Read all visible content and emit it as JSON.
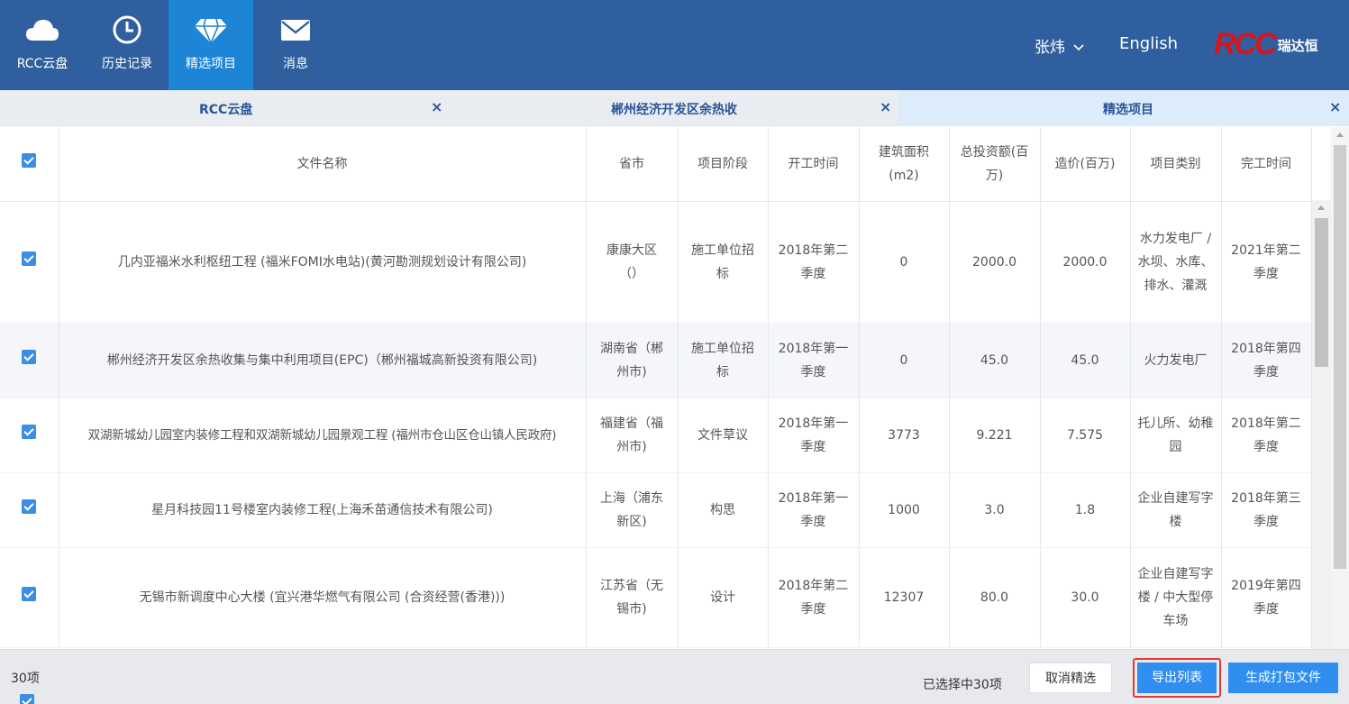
{
  "nav": [
    {
      "label": "RCC云盘",
      "icon": "cloud-icon"
    },
    {
      "label": "历史记录",
      "icon": "clock-icon"
    },
    {
      "label": "精选项目",
      "icon": "diamond-icon"
    },
    {
      "label": "消息",
      "icon": "mail-icon"
    }
  ],
  "header": {
    "user": "张炜",
    "language": "English",
    "logo_mark": "RCC",
    "logo_text": "瑞达恒"
  },
  "tabs": [
    {
      "label": "RCC云盘",
      "close": "×"
    },
    {
      "label": "郴州经济开发区余热收",
      "close": "×"
    },
    {
      "label": "精选项目",
      "close": "×"
    }
  ],
  "table": {
    "columns": [
      "文件名称",
      "省市",
      "项目阶段",
      "开工时间",
      "建筑面积(m2)",
      "总投资额(百万)",
      "造价(百万)",
      "项目类别",
      "完工时间"
    ],
    "rows": [
      {
        "name": "几内亚福米水利枢纽工程 (福米FOMI水电站)(黄河勘测规划设计有限公司)",
        "province": "康康大区（）",
        "stage": "施工单位招标",
        "start": "2018年第二季度",
        "area": "0",
        "investment": "2000.0",
        "cost": "2000.0",
        "category": "水力发电厂 / 水坝、水库、排水、灌溉",
        "finish": "2021年第二季度"
      },
      {
        "name": "郴州经济开发区余热收集与集中利用项目(EPC)（郴州福城高新投资有限公司)",
        "province": "湖南省（郴州市)",
        "stage": "施工单位招标",
        "start": "2018年第一季度",
        "area": "0",
        "investment": "45.0",
        "cost": "45.0",
        "category": "火力发电厂",
        "finish": "2018年第四季度"
      },
      {
        "name": "双湖新城幼儿园室内装修工程和双湖新城幼儿园景观工程 (福州市仓山区仓山镇人民政府)",
        "province": "福建省（福州市)",
        "stage": "文件草议",
        "start": "2018年第一季度",
        "area": "3773",
        "investment": "9.221",
        "cost": "7.575",
        "category": "托儿所、幼稚园",
        "finish": "2018年第二季度"
      },
      {
        "name": "星月科技园11号楼室内装修工程(上海禾苗通信技术有限公司)",
        "province": "上海（浦东新区)",
        "stage": "构思",
        "start": "2018年第一季度",
        "area": "1000",
        "investment": "3.0",
        "cost": "1.8",
        "category": "企业自建写字楼",
        "finish": "2018年第三季度"
      },
      {
        "name": "无锡市新调度中心大楼 (宜兴港华燃气有限公司 (合资经营(香港)))",
        "province": "江苏省（无锡市)",
        "stage": "设计",
        "start": "2018年第二季度",
        "area": "12307",
        "investment": "80.0",
        "cost": "30.0",
        "category": "企业自建写字楼 / 中大型停车场",
        "finish": "2019年第四季度"
      }
    ]
  },
  "footer": {
    "count": "30项",
    "selected": "已选择中30项",
    "cancel": "取消精选",
    "export": "导出列表",
    "generate": "生成打包文件"
  }
}
